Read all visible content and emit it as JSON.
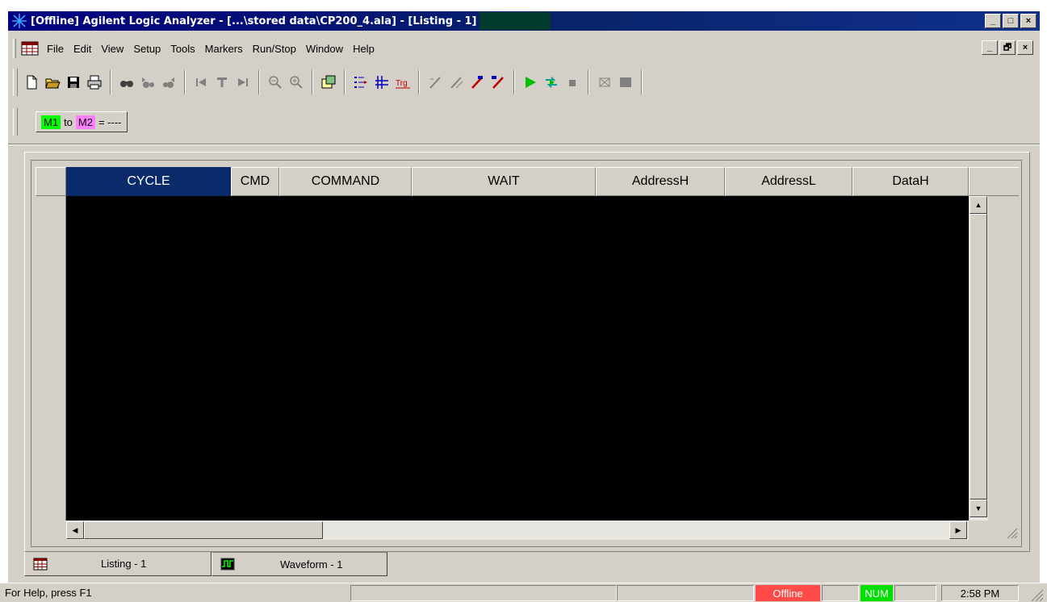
{
  "window": {
    "title": "[Offline] Agilent Logic Analyzer  - [...\\stored data\\CP200_4.ala] - [Listing - 1]",
    "minimize_glyph": "_",
    "maximize_glyph": "□",
    "close_glyph": "×",
    "restore_glyph": "🗗"
  },
  "menu": {
    "items": [
      "File",
      "Edit",
      "View",
      "Setup",
      "Tools",
      "Markers",
      "Run/Stop",
      "Window",
      "Help"
    ]
  },
  "toolbar": {
    "icons": [
      "new-icon",
      "open-icon",
      "save-icon",
      "print-icon",
      "find-icon",
      "find-previous-icon",
      "find-next-icon",
      "go-to-start-icon",
      "go-to-trigger-icon",
      "go-to-end-icon",
      "zoom-out-icon",
      "zoom-in-icon",
      "properties-icon",
      "bus-signal-icon",
      "sampling-icon",
      "trigger-icon",
      "marker-place-icon",
      "marker-next-icon",
      "marker-label-icon",
      "marker-edit-icon",
      "run-icon",
      "run-repetitive-icon",
      "stop-icon",
      "clear-icon",
      "halt-icon"
    ],
    "trigger_label": "Trg"
  },
  "markers": {
    "m1": "M1",
    "to": "to",
    "m2": "M2",
    "equals": "= ----"
  },
  "listing": {
    "columns": [
      {
        "label": "CYCLE",
        "active": true
      },
      {
        "label": "CMD",
        "active": false
      },
      {
        "label": "COMMAND",
        "active": false
      },
      {
        "label": "WAIT",
        "active": false
      },
      {
        "label": "AddressH",
        "active": false
      },
      {
        "label": "AddressL",
        "active": false
      },
      {
        "label": "DataH",
        "active": false
      }
    ],
    "active_header_color": "#0a2a6a"
  },
  "tabs": [
    {
      "label": "Listing - 1",
      "active": true,
      "icon": "listing-icon"
    },
    {
      "label": "Waveform - 1",
      "active": false,
      "icon": "waveform-icon"
    }
  ],
  "status": {
    "help_text": "For Help, press F1",
    "offline": "Offline",
    "num": "NUM",
    "time": "2:58 PM",
    "offline_color": "#ff4a4a",
    "num_color": "#00e000"
  }
}
